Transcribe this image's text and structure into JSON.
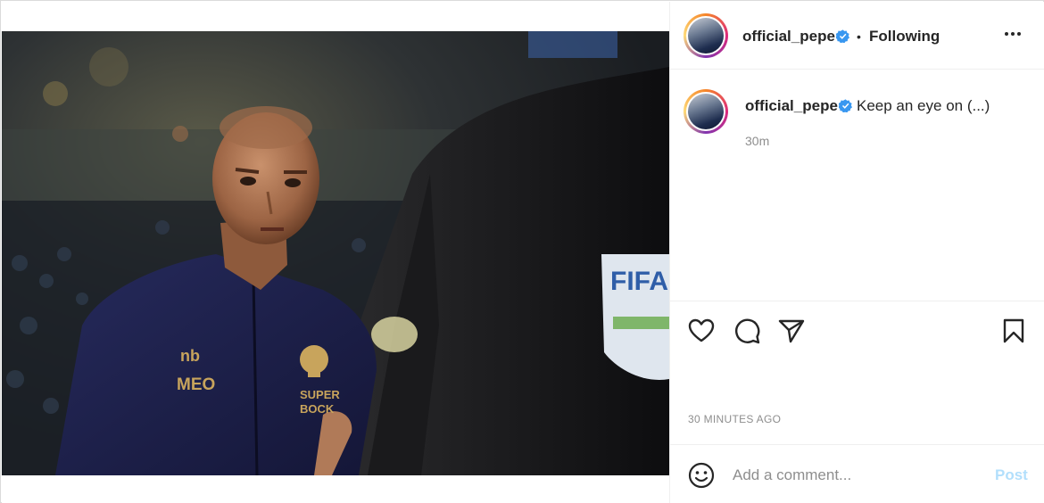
{
  "post": {
    "username": "official_pepe",
    "follow_separator": "•",
    "follow_status": "Following",
    "caption": "Keep an eye on (...)",
    "caption_time": "30m",
    "timestamp": "30 MINUTES AGO"
  },
  "photo": {
    "jersey_logo_text": "MEO",
    "club_text_1": "SUPER",
    "club_text_2": "BOCK",
    "badge_text": "FIFA"
  },
  "comment": {
    "placeholder": "Add a comment...",
    "post_label": "Post"
  },
  "icons": {
    "verified": "verified-badge-icon",
    "more": "more-options-icon",
    "like": "heart-icon",
    "comment": "comment-bubble-icon",
    "share": "paper-plane-icon",
    "save": "bookmark-icon",
    "emoji": "emoji-icon"
  },
  "colors": {
    "verified_blue": "#3897f0",
    "post_button_disabled": "#b2dffc",
    "muted_text": "#8e8e8e"
  }
}
